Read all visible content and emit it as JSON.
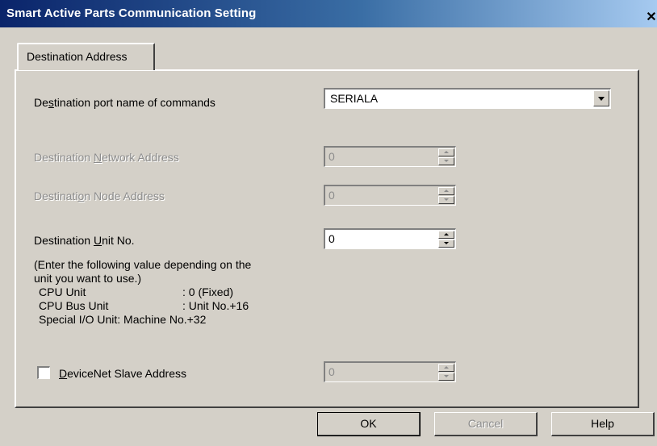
{
  "window": {
    "title": "Smart Active Parts Communication Setting",
    "close_glyph": "✕"
  },
  "tabs": [
    {
      "label": "Destination Address",
      "selected": true
    }
  ],
  "fields": {
    "port_name": {
      "label_pre": "De",
      "label_mnemonic": "s",
      "label_post": "tination port name of commands",
      "value": "SERIALA"
    },
    "network_address": {
      "label_pre": "Destination ",
      "label_mnemonic": "N",
      "label_post": "etwork Address",
      "value": "0",
      "enabled": false
    },
    "node_address": {
      "label_pre": "Destinati",
      "label_mnemonic": "o",
      "label_post": "n Node Address",
      "value": "0",
      "enabled": false
    },
    "unit_no": {
      "label_pre": "Destination ",
      "label_mnemonic": "U",
      "label_post": "nit No.",
      "value": "0",
      "enabled": true
    },
    "devicenet": {
      "label_pre": "",
      "label_mnemonic": "D",
      "label_post": "eviceNet Slave Address",
      "checked": false,
      "value": "0",
      "enabled": false
    }
  },
  "help_text": {
    "line1": "(Enter the following value depending on the",
    "line2": "unit you want to use.)",
    "rows": [
      {
        "name": "CPU Unit",
        "value": ": 0 (Fixed)"
      },
      {
        "name": "CPU Bus Unit",
        "value": ": Unit No.+16"
      }
    ],
    "line_special": "Special I/O Unit: Machine No.+32"
  },
  "buttons": {
    "ok": "OK",
    "cancel": "Cancel",
    "help": "Help"
  }
}
